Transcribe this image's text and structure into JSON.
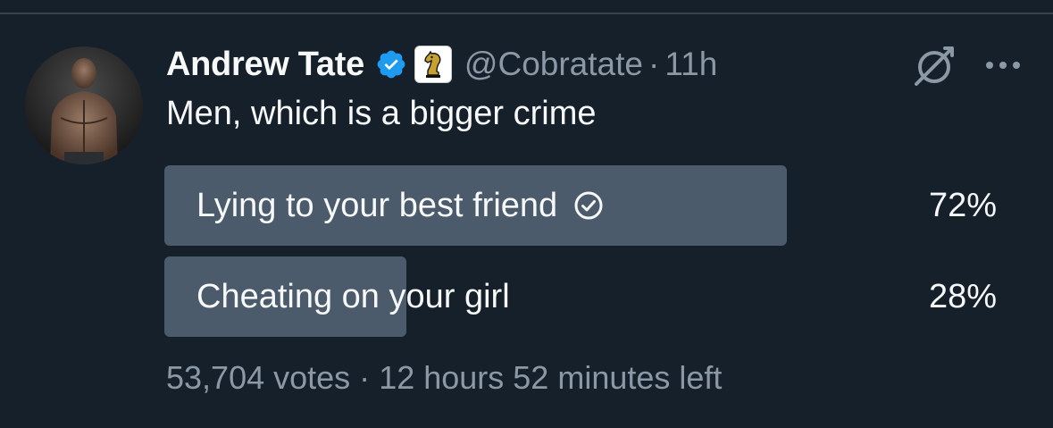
{
  "tweet": {
    "display_name": "Andrew Tate",
    "handle": "@Cobratate",
    "separator": "·",
    "time": "11h",
    "text": "Men, which is a bigger crime"
  },
  "poll": {
    "options": [
      {
        "label": "Lying to your best friend",
        "percent_label": "72%",
        "fraction": 0.72,
        "winner": true
      },
      {
        "label": "Cheating on your girl",
        "percent_label": "28%",
        "fraction": 0.28,
        "winner": false
      }
    ],
    "votes": "53,704 votes",
    "separator": "·",
    "time_left": "12 hours 52 minutes left"
  },
  "icons": {
    "verified": "verified-badge-icon",
    "affiliate": "chess-knight-affiliate-icon",
    "grok": "grok-icon",
    "more": "more-options-icon",
    "winner_check": "check-circle-icon"
  },
  "colors": {
    "background": "#15202b",
    "text": "#f7f9f9",
    "secondary_text": "#8b98a5",
    "poll_bar": "#4b5b6b",
    "verified_blue": "#1d9bf0"
  }
}
